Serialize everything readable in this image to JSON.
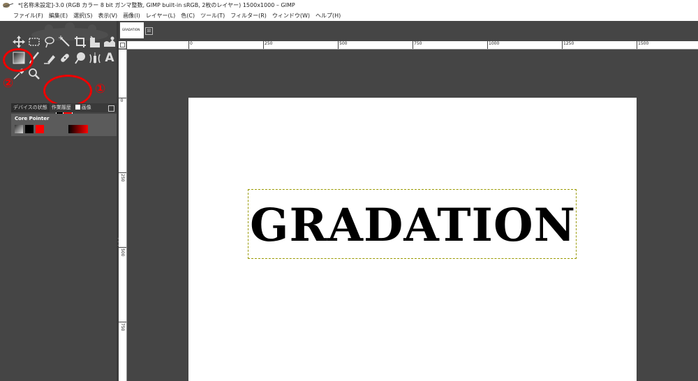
{
  "window": {
    "title": "*[名称未設定]-3.0 (RGB カラー 8 bit ガンマ整数, GIMP built-in sRGB, 2枚のレイヤー) 1500x1000 – GIMP"
  },
  "menu": {
    "items": [
      "ファイル(F)",
      "編集(E)",
      "選択(S)",
      "表示(V)",
      "画像(I)",
      "レイヤー(L)",
      "色(C)",
      "ツール(T)",
      "フィルター(R)",
      "ウィンドウ(W)",
      "ヘルプ(H)"
    ]
  },
  "toolbox": {
    "row1": [
      "move-tool-icon",
      "rect-select-tool-icon",
      "free-select-tool-icon",
      "fuzzy-select-tool-icon",
      "crop-tool-icon",
      "unified-transform-tool-icon",
      "warp-transform-tool-icon"
    ],
    "row2": [
      "gradient-tool-icon",
      "paintbrush-tool-icon",
      "eraser-tool-icon",
      "heal-tool-icon",
      "smudge-tool-icon",
      "paths-tool-icon",
      "text-tool-icon"
    ],
    "row3": [
      "color-picker-tool-icon",
      "zoom-tool-icon"
    ],
    "text_tool_glyph": "A",
    "annotations": {
      "fg_bg_marker": "①",
      "gradient_marker": "②",
      "marker_color": "#ee0000"
    },
    "colors": {
      "foreground": "#000000",
      "background": "#ff0000"
    }
  },
  "dock": {
    "tabs": [
      "デバイスの状態",
      "作業履歴",
      "画像"
    ],
    "device_name": "Core Pointer"
  },
  "image_tab": {
    "thumb_text": "GRADATION",
    "close_glyph": "⊠"
  },
  "ruler": {
    "h_labels": [
      "0",
      "250",
      "500",
      "750",
      "1000",
      "1250",
      "1500"
    ],
    "v_labels": [
      "0",
      "250",
      "500",
      "750"
    ]
  },
  "canvas": {
    "text": "GRADATION"
  }
}
